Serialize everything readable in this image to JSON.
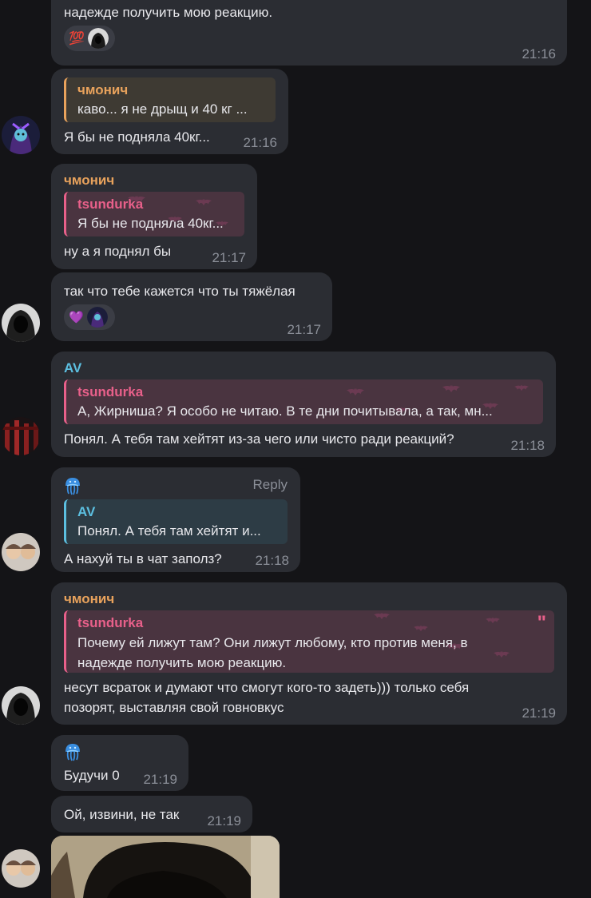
{
  "messages": {
    "m1": {
      "text": "надежде получить мою реакцию.",
      "reaction": "💯",
      "time": "21:16"
    },
    "m2": {
      "quote_sender": "чмонич",
      "quote_text": "каво... я не дрыщ и 40 кг ...",
      "text": "Я бы не подняла 40кг...",
      "time": "21:16"
    },
    "m3": {
      "sender": "чмонич",
      "quote_sender": "tsundurka",
      "quote_text": "Я бы не подняла 40кг...",
      "text": "ну а я поднял бы",
      "time": "21:17"
    },
    "m4": {
      "text": "так что тебе кажется что ты тяжёлая",
      "reaction": "💜",
      "time": "21:17"
    },
    "m5": {
      "sender": "AV",
      "quote_sender": "tsundurka",
      "quote_text": "А, Жирниша? Я особо не читаю. В те дни почитывала, а так, мн...",
      "text": "Понял. А тебя там хейтят из-за чего или чисто ради реакций?",
      "time": "21:18"
    },
    "m6": {
      "reply_label": "Reply",
      "quote_sender": "AV",
      "quote_text": "Понял. А тебя там хейтят и...",
      "text": "А нахуй ты в чат заполз?",
      "time": "21:18"
    },
    "m7": {
      "sender": "чмонич",
      "quote_sender": "tsundurka",
      "quote_line1": "Почему ей лижут там? Они лижут любому, кто против меня, в",
      "quote_line2": "надежде получить мою реакцию.",
      "text_line1": "несут всраток и думают что смогут кого-то задеть))) только себя",
      "text_line2": "позорят, выставляя свой говновкус",
      "time": "21:19"
    },
    "m8": {
      "text": "Будучи 0",
      "time": "21:19"
    },
    "m9": {
      "text": "Ой, извини, не так",
      "time": "21:19"
    }
  },
  "colors": {
    "orange_name": "#e8a25c",
    "pink_name": "#e8608a",
    "cyan_name": "#5cbfe0",
    "bubble": "#2b2d33",
    "background": "#141417"
  }
}
